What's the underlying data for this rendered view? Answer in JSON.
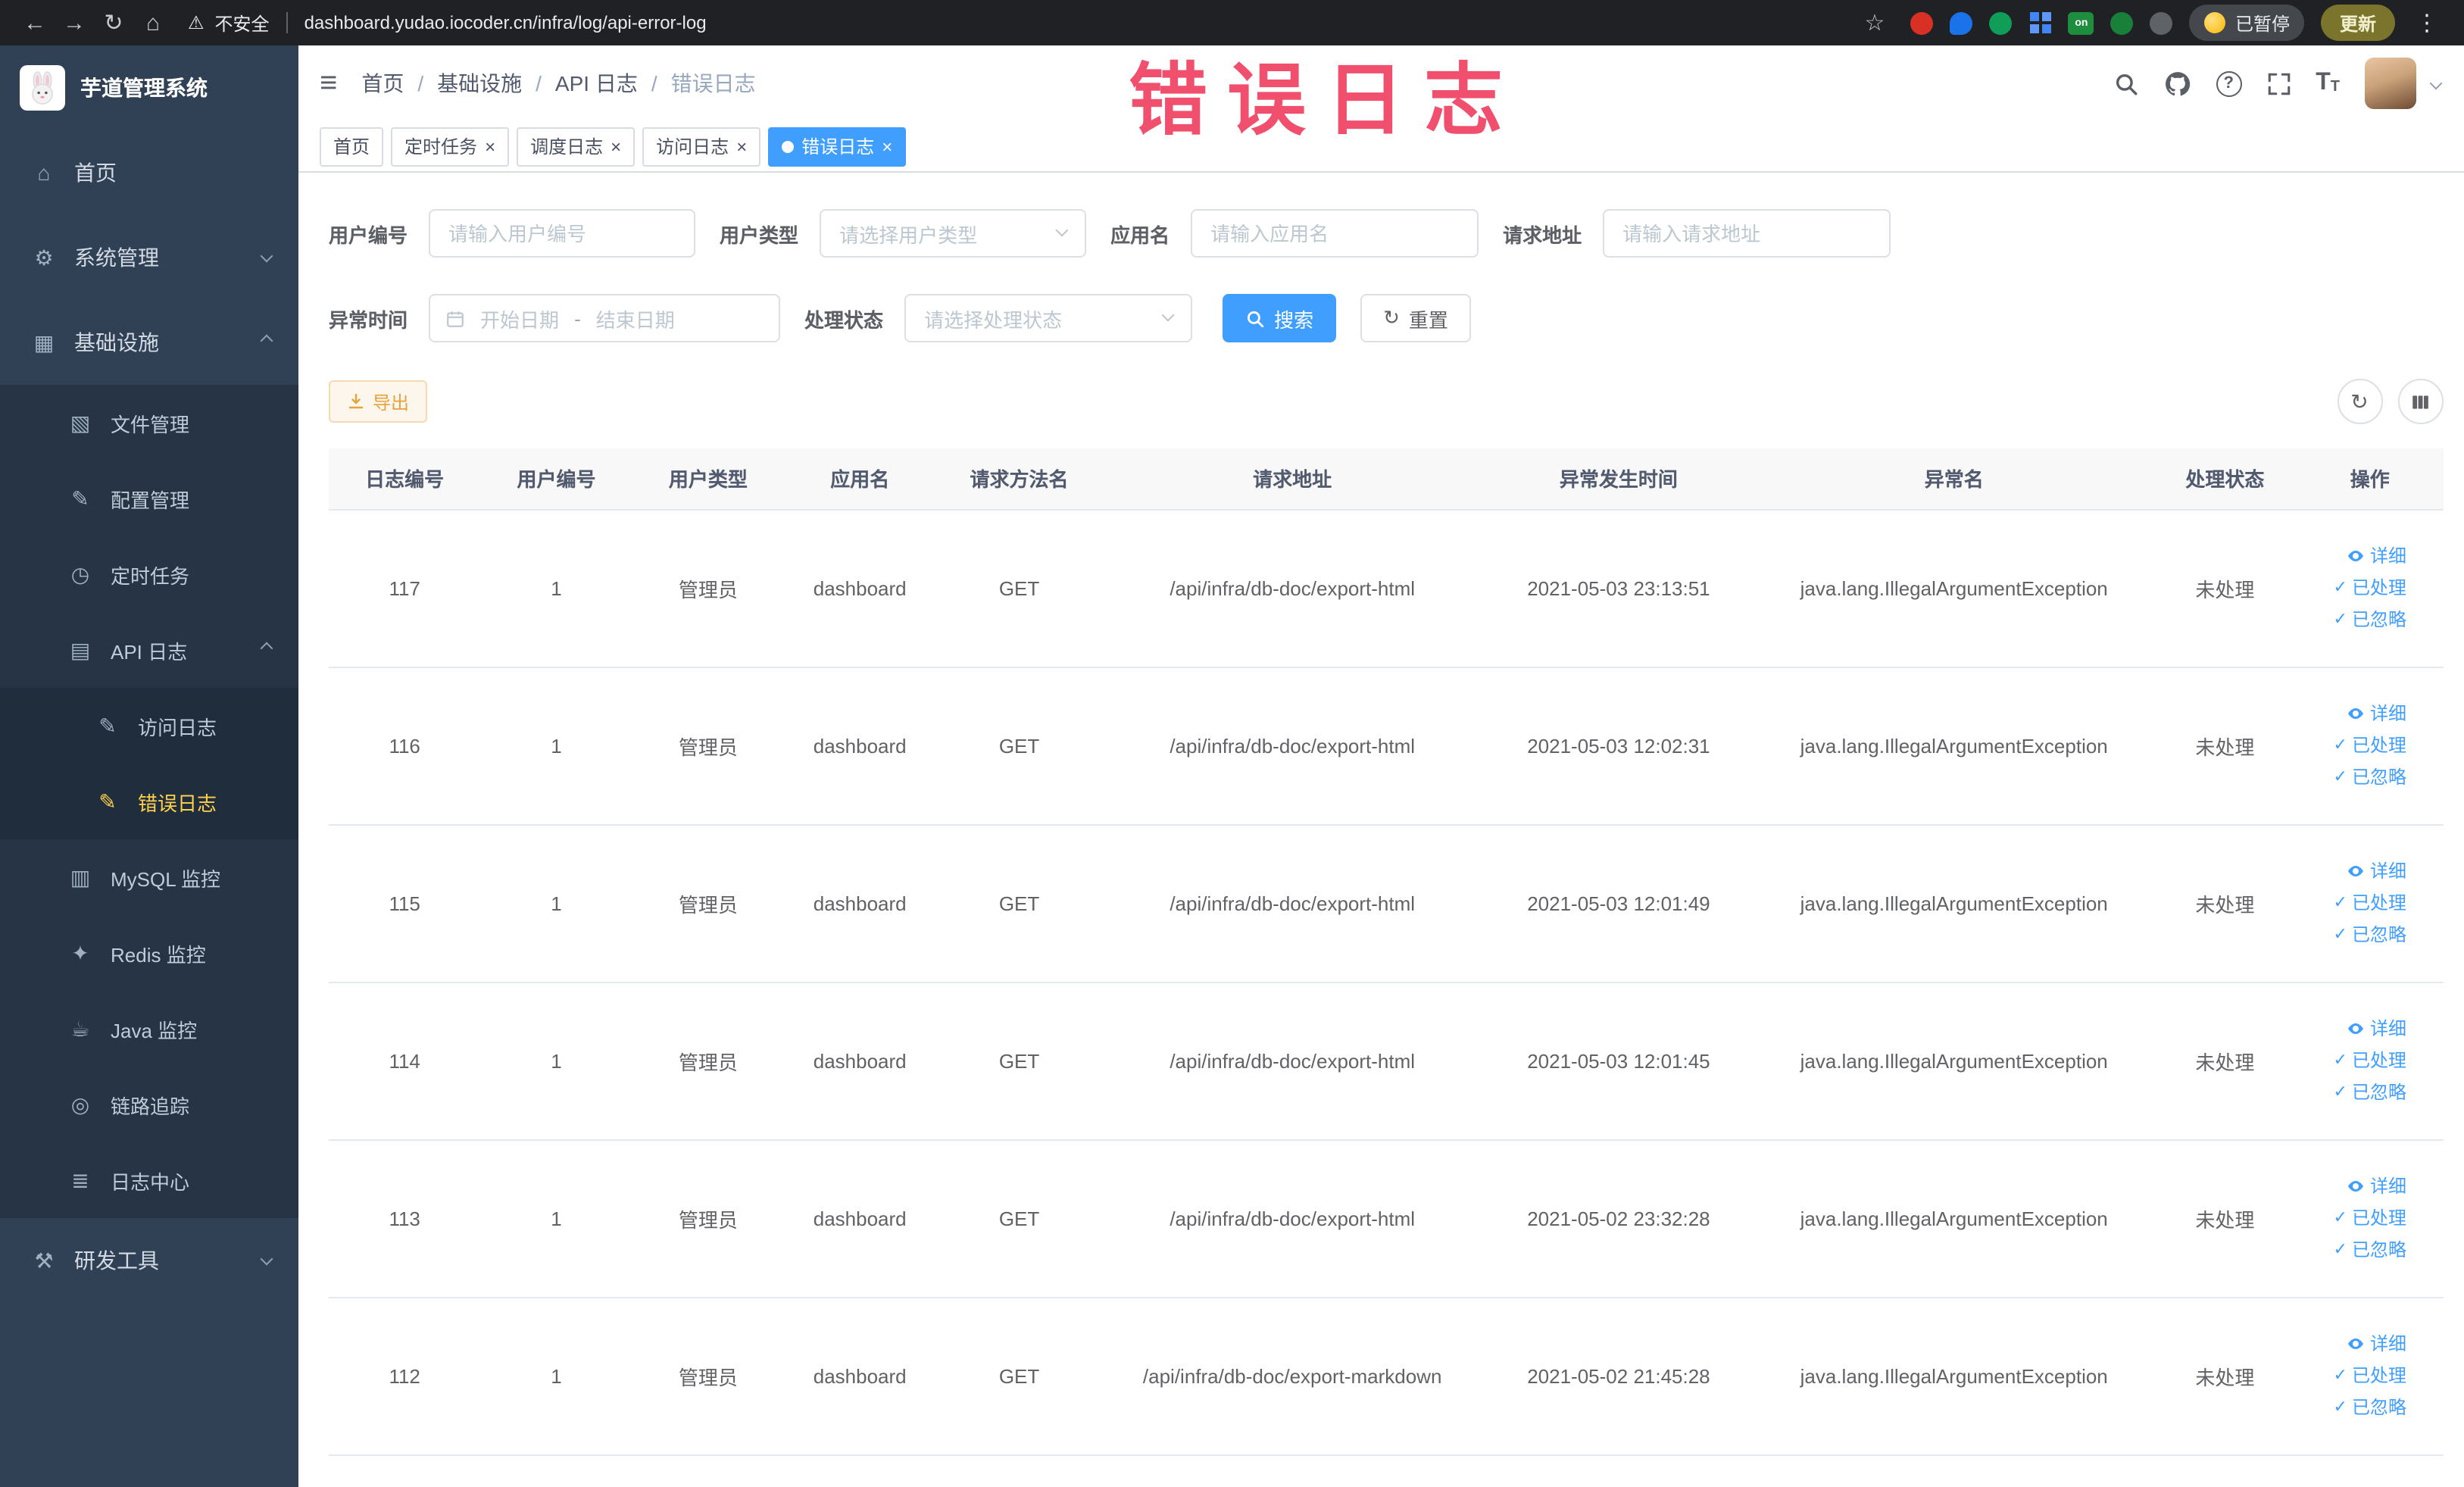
{
  "watermark_text": "错误日志",
  "browser": {
    "back_icon": "←",
    "forward_icon": "→",
    "reload_icon": "↻",
    "home_icon": "⌂",
    "warning_icon": "⚠",
    "security_label": "不安全",
    "url": "dashboard.yudao.iocoder.cn/infra/log/api-error-log",
    "star_icon": "☆",
    "extension_badge_on": "on",
    "paused_label": "已暂停",
    "update_label": "更新",
    "kebab_icon": "⋮"
  },
  "sidebar": {
    "logo_title": "芋道管理系统",
    "items": [
      {
        "label": "首页",
        "icon": "⌂"
      },
      {
        "label": "系统管理",
        "icon": "⚙"
      },
      {
        "label": "基础设施",
        "icon": "▦"
      },
      {
        "label": "文件管理",
        "icon": "▧"
      },
      {
        "label": "配置管理",
        "icon": "✎"
      },
      {
        "label": "定时任务",
        "icon": "◷"
      },
      {
        "label": "API 日志",
        "icon": "▤"
      },
      {
        "label": "访问日志",
        "icon": "✎"
      },
      {
        "label": "错误日志",
        "icon": "✎"
      },
      {
        "label": "MySQL 监控",
        "icon": "▥"
      },
      {
        "label": "Redis 监控",
        "icon": "✦"
      },
      {
        "label": "Java 监控",
        "icon": "☕"
      },
      {
        "label": "链路追踪",
        "icon": "◎"
      },
      {
        "label": "日志中心",
        "icon": "≣"
      },
      {
        "label": "研发工具",
        "icon": "⚒"
      }
    ]
  },
  "header": {
    "hamburger_icon": "≡",
    "breadcrumb": [
      "首页",
      "基础设施",
      "API 日志",
      "错误日志"
    ],
    "breadcrumb_separator": "/",
    "question_icon": "?",
    "font_icon_large": "T",
    "font_icon_small": "T"
  },
  "tabs": [
    {
      "label": "首页"
    },
    {
      "label": "定时任务"
    },
    {
      "label": "调度日志"
    },
    {
      "label": "访问日志"
    },
    {
      "label": "错误日志"
    }
  ],
  "close_icon": "×",
  "filters": {
    "user_id": {
      "label": "用户编号",
      "placeholder": "请输入用户编号"
    },
    "user_type": {
      "label": "用户类型",
      "placeholder": "请选择用户类型"
    },
    "app_name": {
      "label": "应用名",
      "placeholder": "请输入应用名"
    },
    "request_url": {
      "label": "请求地址",
      "placeholder": "请输入请求地址"
    },
    "exception_time": {
      "label": "异常时间",
      "start_placeholder": "开始日期",
      "separator": "-",
      "end_placeholder": "结束日期"
    },
    "process_status": {
      "label": "处理状态",
      "placeholder": "请选择处理状态"
    },
    "search_label": "搜索",
    "reset_label": "重置",
    "reset_icon": "↻"
  },
  "toolbar": {
    "export_label": "导出",
    "refresh_icon": "↻"
  },
  "table": {
    "columns": [
      "日志编号",
      "用户编号",
      "用户类型",
      "应用名",
      "请求方法名",
      "请求地址",
      "异常发生时间",
      "异常名",
      "处理状态",
      "操作"
    ],
    "actions": {
      "detail": "详细",
      "processed": "已处理",
      "ignored": "已忽略",
      "check_icon": "✓"
    },
    "rows": [
      {
        "id": "117",
        "user_id": "1",
        "user_type": "管理员",
        "app": "dashboard",
        "method": "GET",
        "url": "/api/infra/db-doc/export-html",
        "time": "2021-05-03 23:13:51",
        "exception": "java.lang.IllegalArgumentException",
        "status": "未处理"
      },
      {
        "id": "116",
        "user_id": "1",
        "user_type": "管理员",
        "app": "dashboard",
        "method": "GET",
        "url": "/api/infra/db-doc/export-html",
        "time": "2021-05-03 12:02:31",
        "exception": "java.lang.IllegalArgumentException",
        "status": "未处理"
      },
      {
        "id": "115",
        "user_id": "1",
        "user_type": "管理员",
        "app": "dashboard",
        "method": "GET",
        "url": "/api/infra/db-doc/export-html",
        "time": "2021-05-03 12:01:49",
        "exception": "java.lang.IllegalArgumentException",
        "status": "未处理"
      },
      {
        "id": "114",
        "user_id": "1",
        "user_type": "管理员",
        "app": "dashboard",
        "method": "GET",
        "url": "/api/infra/db-doc/export-html",
        "time": "2021-05-03 12:01:45",
        "exception": "java.lang.IllegalArgumentException",
        "status": "未处理"
      },
      {
        "id": "113",
        "user_id": "1",
        "user_type": "管理员",
        "app": "dashboard",
        "method": "GET",
        "url": "/api/infra/db-doc/export-html",
        "time": "2021-05-02 23:32:28",
        "exception": "java.lang.IllegalArgumentException",
        "status": "未处理"
      },
      {
        "id": "112",
        "user_id": "1",
        "user_type": "管理员",
        "app": "dashboard",
        "method": "GET",
        "url": "/api/infra/db-doc/export-markdown",
        "time": "2021-05-02 21:45:28",
        "exception": "java.lang.IllegalArgumentException",
        "status": "未处理"
      }
    ]
  }
}
